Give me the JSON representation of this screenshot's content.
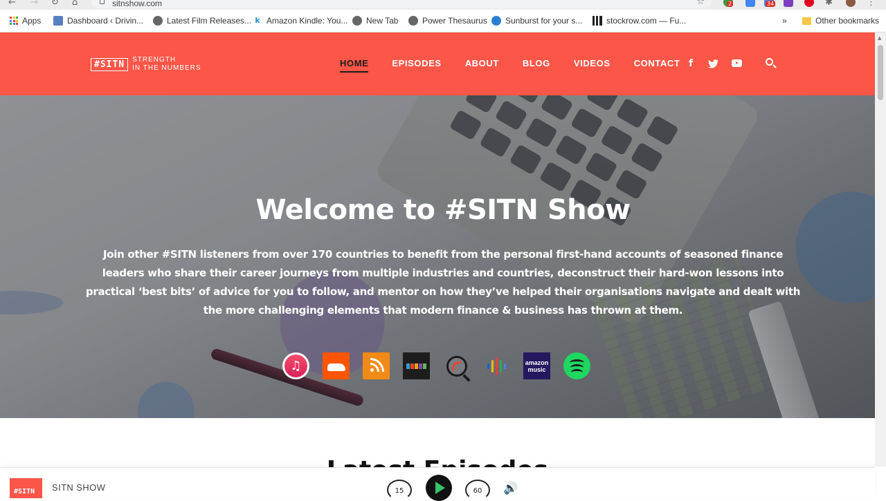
{
  "browser": {
    "url": "sitnshow.com",
    "badges": [
      "2",
      "34"
    ],
    "bookmarks": [
      {
        "label": "Apps"
      },
      {
        "label": "Dashboard ‹ Drivin..."
      },
      {
        "label": "Latest Film Releases..."
      },
      {
        "label": "Amazon Kindle: You..."
      },
      {
        "label": "New Tab"
      },
      {
        "label": "Power Thesaurus"
      },
      {
        "label": "Sunburst for your s..."
      },
      {
        "label": "stockrow.com — Fu..."
      }
    ],
    "overflow": "»",
    "other_bookmarks": "Other bookmarks"
  },
  "site": {
    "logo_mark": "#SITN",
    "logo_line1": "STRENGTH",
    "logo_line2": "IN THE NUMBERS",
    "brand_color": "#fb5647",
    "nav": [
      "HOME",
      "EPISODES",
      "ABOUT",
      "BLOG",
      "VIDEOS",
      "CONTACT"
    ],
    "active_nav": "HOME",
    "social": [
      "facebook-icon",
      "twitter-icon",
      "youtube-icon"
    ]
  },
  "hero": {
    "title": "Welcome to #SITN Show",
    "description": "Join other #SITN listeners from over 170 countries to benefit from the personal first-hand accounts of seasoned finance leaders who share their career journeys from multiple industries and countries, deconstruct their hard-won lessons into practical ‘best bits’ of advice for you to follow, and mentor on how they’ve helped their organisations navigate and dealt with the more challenging elements that modern finance & business has thrown at them.",
    "platforms": [
      "apple-podcasts-icon",
      "soundcloud-icon",
      "rss-icon",
      "stitcher-icon",
      "castbox-icon",
      "google-podcasts-icon",
      "amazon-music-icon",
      "spotify-icon"
    ],
    "amazon_label_1": "amazon",
    "amazon_label_2": "music"
  },
  "section": {
    "heading": "Latest Episodes"
  },
  "player": {
    "thumb_text": "#SITN",
    "show_name": "SITN SHOW",
    "skip_back": "15",
    "skip_forward": "60"
  }
}
